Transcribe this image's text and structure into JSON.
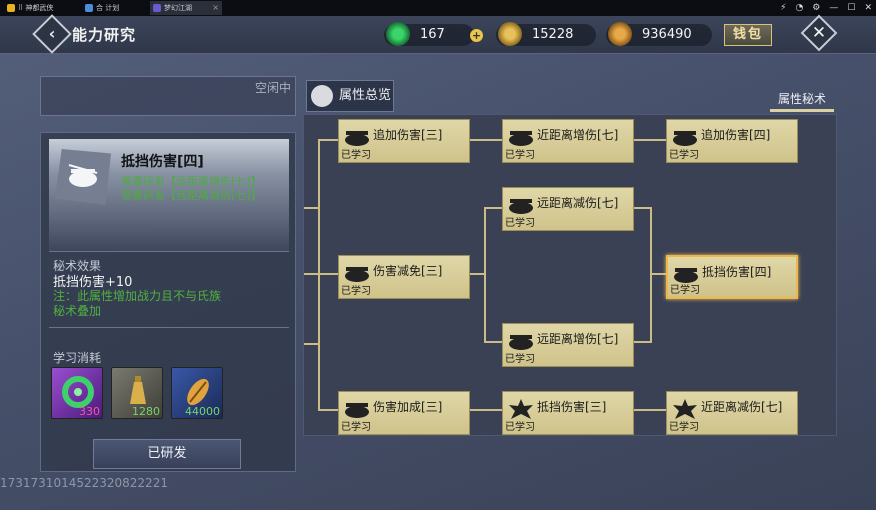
{
  "taskbar": {
    "tabs": [
      {
        "label": "⠿ 神都武侠",
        "color": "#e6b422"
      },
      {
        "label": "合 计划",
        "color": "#4a8fd8"
      },
      {
        "label": "梦幻江湖",
        "color": "#6a5acd"
      }
    ],
    "icons": [
      "⚡",
      "◔",
      "⚙",
      "—",
      "☐",
      "✕"
    ]
  },
  "header": {
    "back_icon": "‹",
    "title": "能力研究",
    "resources": [
      {
        "value": "167",
        "icon": "jade-icon",
        "color": "#2fa34a"
      },
      {
        "value": "15228",
        "icon": "bell-icon",
        "color": "#c9a23c"
      },
      {
        "value": "936490",
        "icon": "shell-icon",
        "color": "#c9902e"
      }
    ],
    "plus": "+",
    "wallet": "钱包",
    "close_icon": "✕"
  },
  "left": {
    "status": "空闲中",
    "skill": {
      "name": "抵挡伤害[四]",
      "req1": "需要研发【远距离增伤[七]】",
      "req2": "需要研发【远距离减伤[七]】"
    },
    "effect_label": "秘术效果",
    "effect_value": "抵挡伤害+10",
    "note1": "注：此属性增加战力且不与氏族",
    "note2": "秘术叠加",
    "cost_label": "学习消耗",
    "costs": [
      {
        "value": "330",
        "icon": "jade-icon",
        "color": "#f05a9a",
        "bg": "#6a2fa0"
      },
      {
        "value": "1280",
        "icon": "bell-icon",
        "color": "#7ad36a",
        "bg": "#5a5a52"
      },
      {
        "value": "44000",
        "icon": "shell-icon",
        "color": "#7ad36a",
        "bg": "#2a3f78"
      }
    ],
    "learned_button": "已研发"
  },
  "timestamp": "1731731014522320822221",
  "tabs": {
    "overview": "属性总览",
    "secret": "属性秘术"
  },
  "tree": {
    "status_learned": "已学习",
    "nodes": [
      {
        "id": "n1",
        "label": "追加伤害[三]",
        "icon": "cauldron-icon"
      },
      {
        "id": "n2",
        "label": "近距离增伤[七]",
        "icon": "cauldron-icon"
      },
      {
        "id": "n3",
        "label": "追加伤害[四]",
        "icon": "cauldron-icon"
      },
      {
        "id": "n4",
        "label": "远距离减伤[七]",
        "icon": "cauldron-icon"
      },
      {
        "id": "n5",
        "label": "伤害减免[三]",
        "icon": "cauldron-icon"
      },
      {
        "id": "n6",
        "label": "抵挡伤害[四]",
        "icon": "cauldron-icon",
        "selected": true
      },
      {
        "id": "n7",
        "label": "远距离增伤[七]",
        "icon": "cauldron-icon"
      },
      {
        "id": "n8",
        "label": "伤害加成[三]",
        "icon": "cauldron-icon"
      },
      {
        "id": "n9",
        "label": "抵挡伤害[三]",
        "icon": "maple-icon"
      },
      {
        "id": "n10",
        "label": "近距离减伤[七]",
        "icon": "maple-icon"
      }
    ]
  }
}
